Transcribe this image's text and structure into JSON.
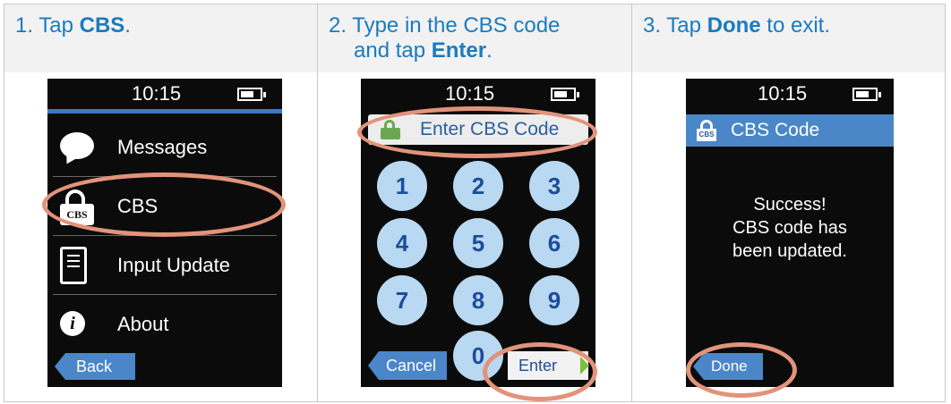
{
  "steps": [
    {
      "number": "1.",
      "pre": "Tap ",
      "bold": "CBS",
      "post": "."
    },
    {
      "number": "2.",
      "line1": "Type in the CBS code",
      "line2_pre": "and tap ",
      "line2_bold": "Enter",
      "line2_post": "."
    },
    {
      "number": "3.",
      "pre": "Tap ",
      "bold": "Done",
      "post": " to exit."
    }
  ],
  "screen1": {
    "time": "10:15",
    "menu": [
      {
        "label": "Messages",
        "icon": "speech-bubble-icon"
      },
      {
        "label": "CBS",
        "icon": "cbs-lock-icon",
        "icon_text": "CBS"
      },
      {
        "label": "Input Update",
        "icon": "input-update-icon"
      },
      {
        "label": "About",
        "icon": "info-icon",
        "icon_text": "i"
      }
    ],
    "back_label": "Back"
  },
  "screen2": {
    "time": "10:15",
    "prompt": "Enter CBS Code",
    "keys": [
      "1",
      "2",
      "3",
      "4",
      "5",
      "6",
      "7",
      "8",
      "9",
      "0"
    ],
    "cancel_label": "Cancel",
    "enter_label": "Enter"
  },
  "screen3": {
    "time": "10:15",
    "title": "CBS Code",
    "title_icon_text": "CBS",
    "message_lines": [
      "Success!",
      "CBS code has",
      "been updated."
    ],
    "done_label": "Done"
  },
  "colors": {
    "step_text": "#1a7bbf",
    "highlight_ring": "#e2937a",
    "screen_blue": "#4a86c8",
    "key_fill": "#b9d8f2",
    "lock_green": "#6aa84f"
  }
}
